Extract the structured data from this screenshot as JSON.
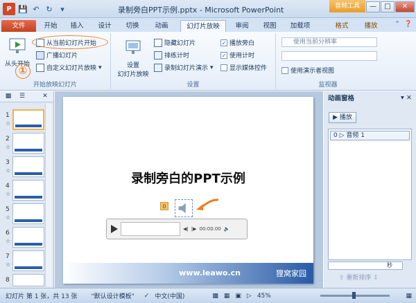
{
  "window": {
    "title": "录制旁白PPT示例.pptx - Microsoft PowerPoint",
    "contextual_tab_group": "音频工具",
    "logo_letter": "P"
  },
  "tabs": [
    "文件",
    "开始",
    "插入",
    "设计",
    "切换",
    "动画",
    "幻灯片放映",
    "审阅",
    "视图",
    "加载项",
    "格式",
    "播放"
  ],
  "ribbon": {
    "start_group": {
      "label": "开始放映幻灯片",
      "from_beginning": "从头开始",
      "from_current": "从当前幻灯片开始",
      "broadcast": "广播幻灯片",
      "custom_show": "自定义幻灯片放映"
    },
    "setup_group": {
      "label": "设置",
      "setup_show_line1": "设置",
      "setup_show_line2": "幻灯片放映",
      "hide_slide": "隐藏幻灯片",
      "rehearse": "排练计时",
      "record_show": "录制幻灯片演示",
      "play_narrations": "播放旁白",
      "use_timings": "使用计时",
      "show_media_controls": "显示媒体控件"
    },
    "monitor_group": {
      "label": "监视器",
      "resolution": "使用当前分辨率",
      "presenter_view": "使用演示者视图"
    }
  },
  "annotation_number": "①",
  "slides": [
    "1",
    "2",
    "3",
    "4",
    "5",
    "6",
    "7",
    "8"
  ],
  "slide": {
    "title": "录制旁白的PPT示例",
    "url": "www.leawo.cn",
    "brand": "狸窝家园",
    "audio_tag": "0",
    "player_time": "00:00.00"
  },
  "anim_pane": {
    "title": "动画窗格",
    "play_label": "播放",
    "item_label": "0 ▷ 音频 1",
    "seconds_label": "秒",
    "reorder_label": "重新排序"
  },
  "status": {
    "slide_info": "幻灯片 第 1 张，共 13 张",
    "theme": "\"默认设计模板\"",
    "language": "中文(中国)",
    "zoom": "45%"
  }
}
